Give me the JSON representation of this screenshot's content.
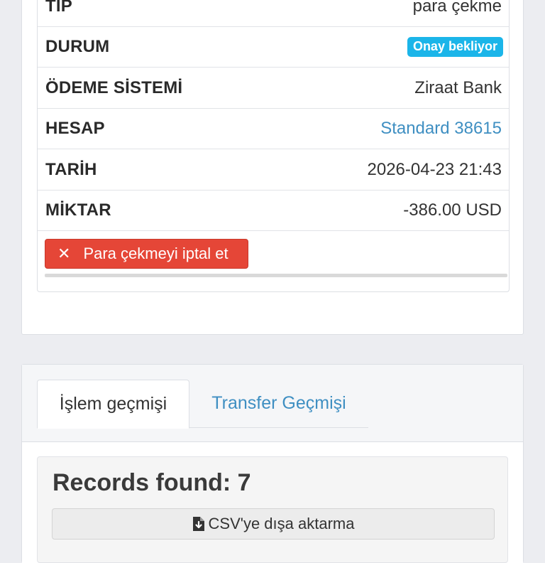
{
  "details": {
    "rows": [
      {
        "label": "TIP",
        "value": "para çekme"
      },
      {
        "label": "DURUM",
        "value": "Onay bekliyor"
      },
      {
        "label": "ÖDEME SİSTEMİ",
        "value": "Ziraat Bank"
      },
      {
        "label": "HESAP",
        "value": "Standard 38615"
      },
      {
        "label": "TARİH",
        "value": "2026-04-23 21:43"
      },
      {
        "label": "MİKTAR",
        "value": "-386.00 USD"
      }
    ],
    "status_color": "#1bb5e9",
    "cancel_button": {
      "icon": "close-icon",
      "label": "Para çekmeyi iptal et",
      "color": "#e54637"
    }
  },
  "history": {
    "tabs": [
      {
        "label": "İşlem geçmişi",
        "active": true
      },
      {
        "label": "Transfer Geçmişi",
        "active": false
      }
    ],
    "records_label": "Records found: 7",
    "export_button": {
      "icon": "file-download-icon",
      "label": "CSV'ye dışa aktarma"
    }
  },
  "colors": {
    "link": "#3f8fc2",
    "background": "#ecedf1"
  }
}
